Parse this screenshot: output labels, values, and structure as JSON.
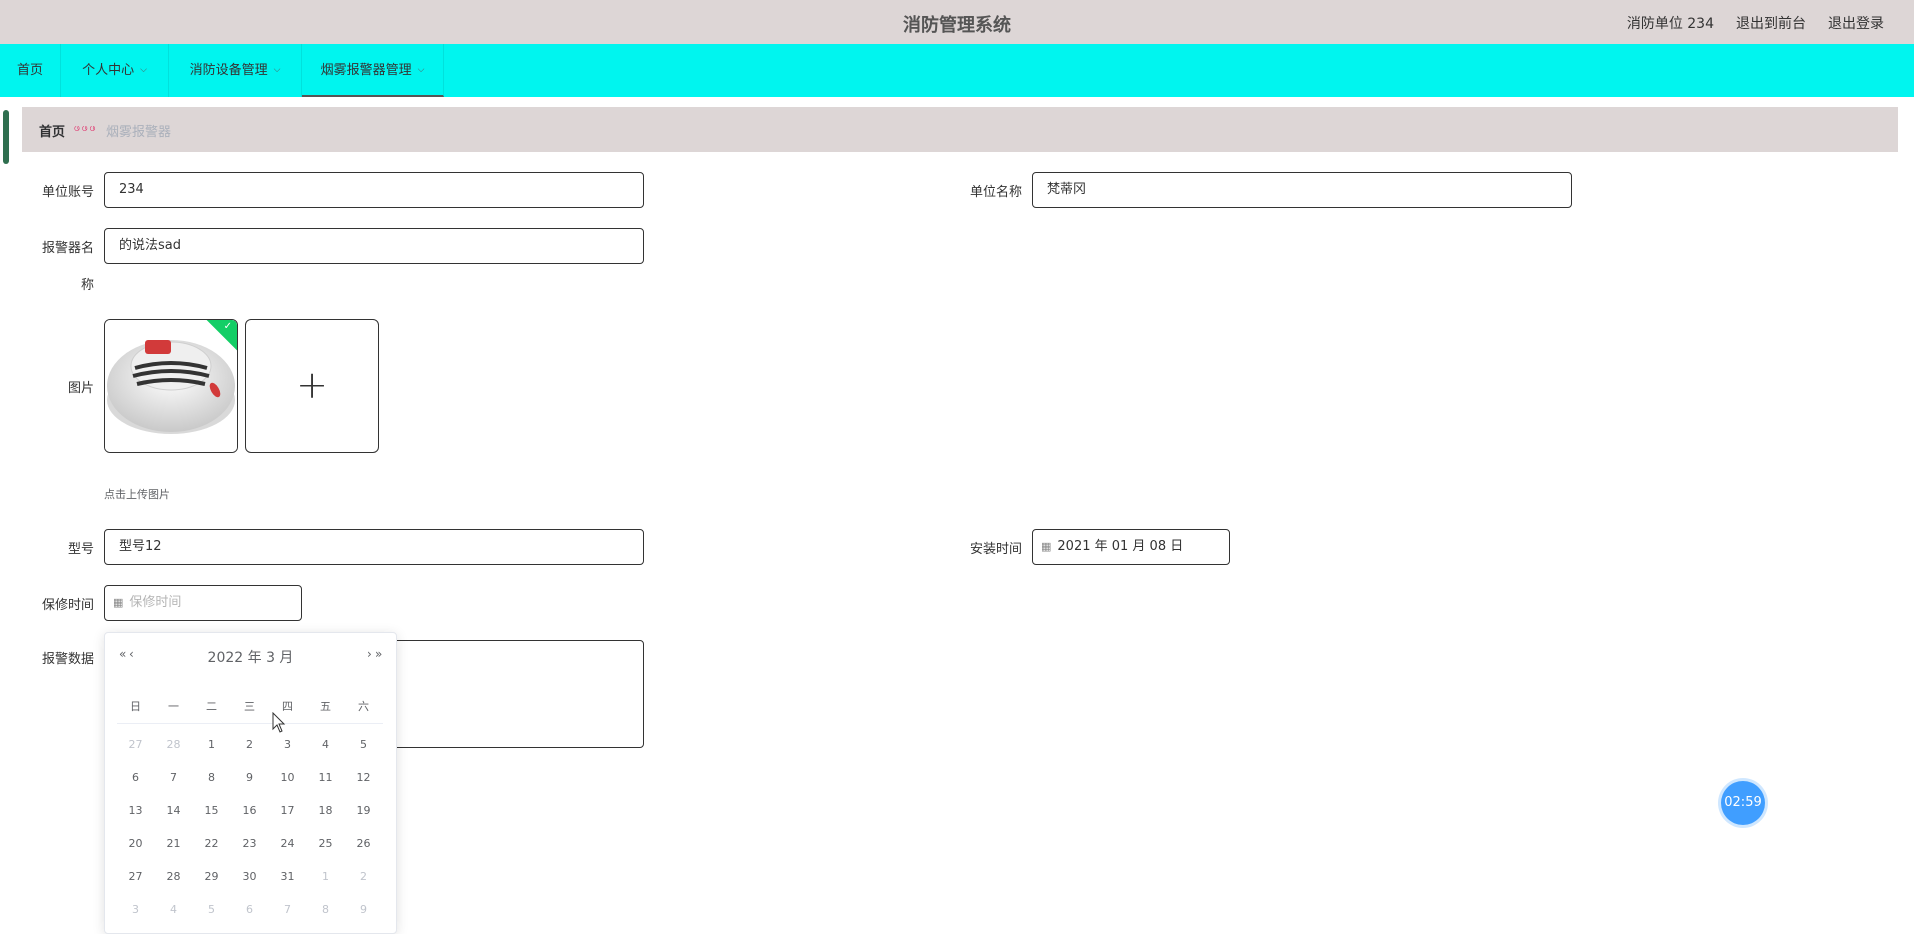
{
  "header": {
    "title": "消防管理系统",
    "user_label": "消防单位 234",
    "back_to_front": "退出到前台",
    "logout": "退出登录"
  },
  "nav": {
    "items": [
      {
        "label": "首页"
      },
      {
        "label": "个人中心"
      },
      {
        "label": "消防设备管理"
      },
      {
        "label": "烟雾报警器管理"
      }
    ]
  },
  "breadcrumb": {
    "home": "首页",
    "separator": "ဖ ဖ ဖ",
    "current": "烟雾报警器"
  },
  "form": {
    "account_label": "单位账号",
    "account_value": "234",
    "unit_name_label": "单位名称",
    "unit_name_value": "梵蒂冈",
    "alarm_name_label_1": "报警器名",
    "alarm_name_label_2": "称",
    "alarm_name_value": "的说法sad",
    "image_label": "图片",
    "upload_tip": "点击上传图片",
    "model_label": "型号",
    "model_value": "型号12",
    "install_time_label": "安装时间",
    "install_time_value": "2021 年 01 月 08 日",
    "warranty_label": "保修时间",
    "warranty_placeholder": "保修时间",
    "alarm_data_label": "报警数据"
  },
  "datepicker": {
    "title": "2022 年  3 月",
    "prev_year": "«",
    "prev_month": "‹",
    "next_month": "›",
    "next_year": "»",
    "weekdays": [
      "日",
      "一",
      "二",
      "三",
      "四",
      "五",
      "六"
    ],
    "weeks": [
      [
        {
          "d": "27",
          "o": true
        },
        {
          "d": "28",
          "o": true
        },
        {
          "d": "1"
        },
        {
          "d": "2"
        },
        {
          "d": "3"
        },
        {
          "d": "4"
        },
        {
          "d": "5"
        }
      ],
      [
        {
          "d": "6"
        },
        {
          "d": "7"
        },
        {
          "d": "8"
        },
        {
          "d": "9"
        },
        {
          "d": "10"
        },
        {
          "d": "11"
        },
        {
          "d": "12"
        }
      ],
      [
        {
          "d": "13"
        },
        {
          "d": "14"
        },
        {
          "d": "15"
        },
        {
          "d": "16"
        },
        {
          "d": "17"
        },
        {
          "d": "18"
        },
        {
          "d": "19"
        }
      ],
      [
        {
          "d": "20"
        },
        {
          "d": "21"
        },
        {
          "d": "22"
        },
        {
          "d": "23"
        },
        {
          "d": "24"
        },
        {
          "d": "25"
        },
        {
          "d": "26"
        }
      ],
      [
        {
          "d": "27"
        },
        {
          "d": "28"
        },
        {
          "d": "29"
        },
        {
          "d": "30"
        },
        {
          "d": "31"
        },
        {
          "d": "1",
          "o": true
        },
        {
          "d": "2",
          "o": true
        }
      ],
      [
        {
          "d": "3",
          "o": true
        },
        {
          "d": "4",
          "o": true
        },
        {
          "d": "5",
          "o": true
        },
        {
          "d": "6",
          "o": true
        },
        {
          "d": "7",
          "o": true
        },
        {
          "d": "8",
          "o": true
        },
        {
          "d": "9",
          "o": true
        }
      ]
    ]
  },
  "timer": "02:59",
  "icons": {
    "calendar": "calendar-icon",
    "plus": "plus-icon",
    "check": "check-icon",
    "chevron": "chevron-down-icon"
  }
}
